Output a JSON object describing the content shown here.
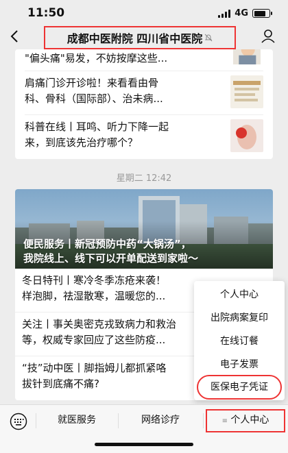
{
  "status_bar": {
    "time": "11:50",
    "network": "4G"
  },
  "header": {
    "title": "成都中医附院 四川省中医院"
  },
  "card1": {
    "articles": [
      {
        "line1": "\"偏头痛\"易发，不妨按摩这些..."
      },
      {
        "line1": "肩痛门诊开诊啦！来看看由骨",
        "line2": "科、骨科（国际部）、治未病..."
      },
      {
        "line1": "科普在线丨耳鸣、听力下降一起",
        "line2": "来，到底该先治疗哪个？"
      }
    ]
  },
  "timestamp": "星期二 12:42",
  "card2": {
    "hero": {
      "line1": "便民服务丨新冠预防中药“大锅汤”，",
      "line2": "我院线上、线下可以开单配送到家啦～"
    },
    "articles": [
      {
        "line1": "冬日特刊丨寒冷冬季冻疮来袭！",
        "line2": "样泡脚，祛湿散寒，温暖您的..."
      },
      {
        "line1": "关注丨事关奥密克戎致病力和救治",
        "line2": "等，权威专家回应了这些防疫..."
      },
      {
        "line1": "“技”动中医丨脚指姆儿都抓紧咯",
        "line2": "拔针到底痛不痛?"
      }
    ]
  },
  "popup_menu": {
    "items": [
      "个人中心",
      "出院病案复印",
      "在线订餐",
      "电子发票",
      "医保电子凭证"
    ]
  },
  "tab_bar": {
    "tabs": [
      "就医服务",
      "网络诊疗",
      "个人中心"
    ]
  },
  "colors": {
    "highlight": "#e33333",
    "background": "#ededed"
  }
}
